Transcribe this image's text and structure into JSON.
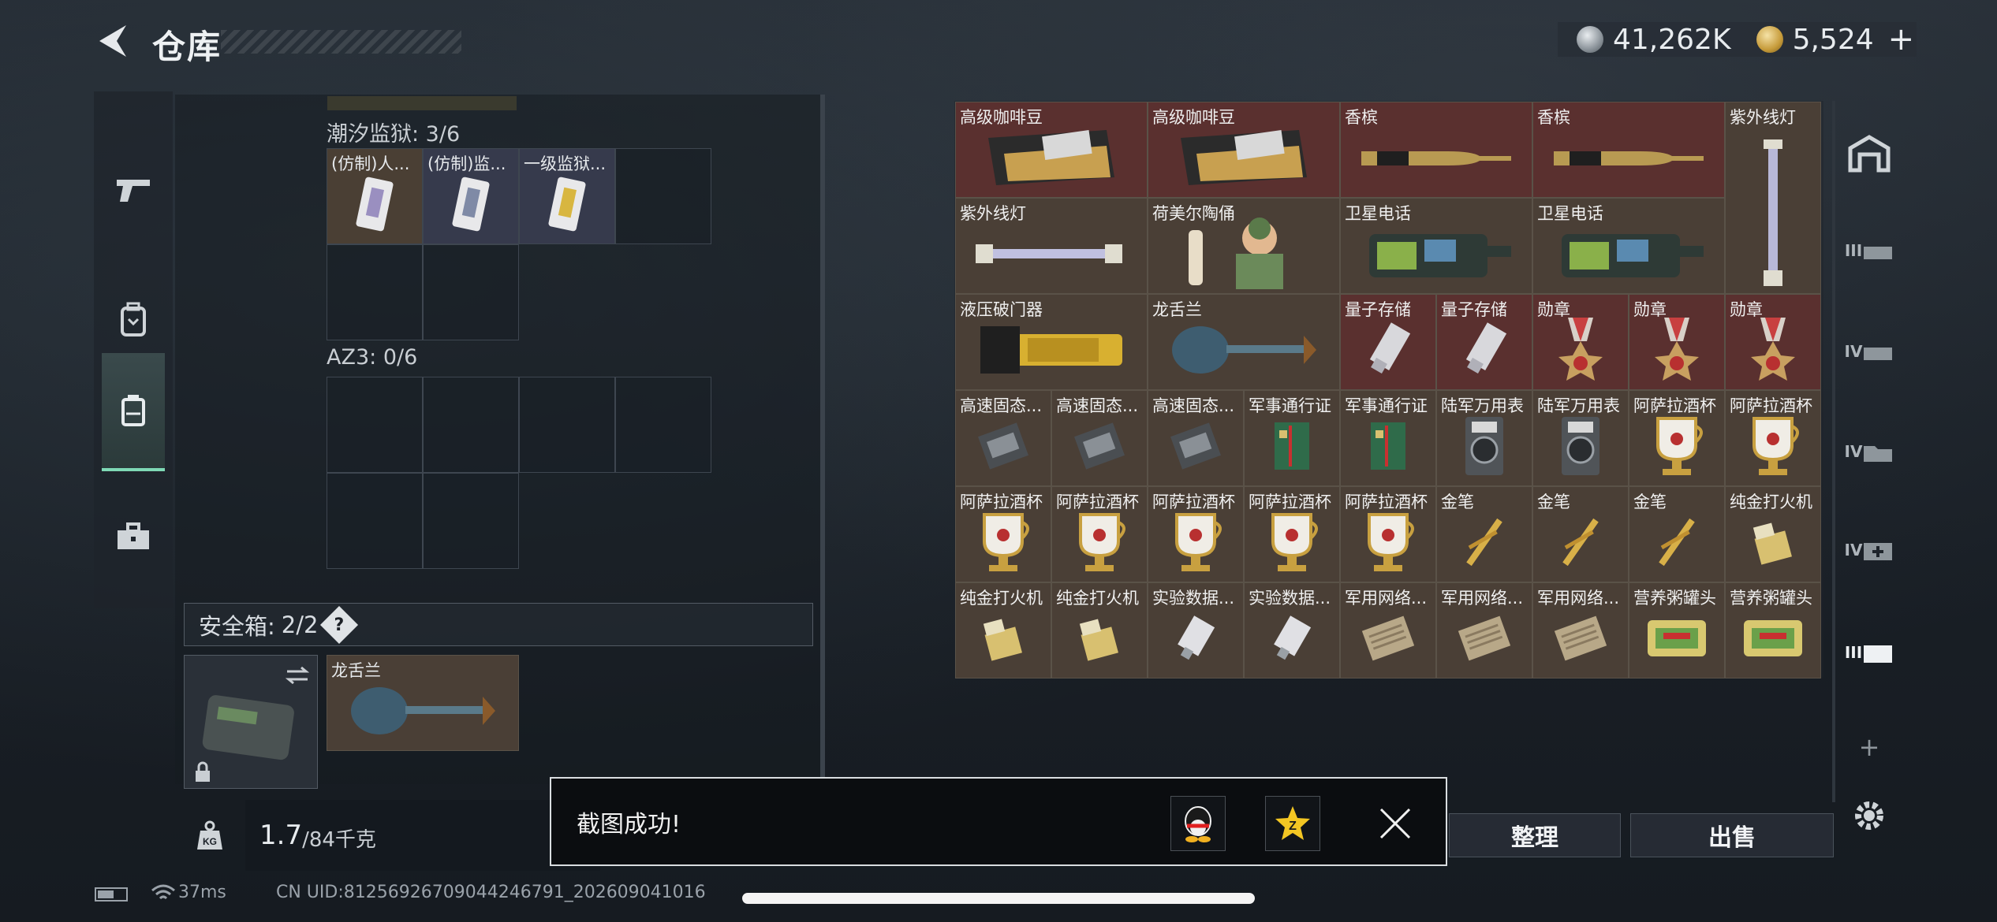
{
  "header": {
    "title": "仓库",
    "back_icon": "back-arrow-icon",
    "currency": [
      {
        "icon": "silver-coin-icon",
        "value": "41,262K"
      },
      {
        "icon": "gold-coin-icon",
        "value": "5,524"
      }
    ],
    "plus_label": "+"
  },
  "left_nav": [
    {
      "icon": "pistol-icon"
    },
    {
      "icon": "backpack-icon"
    },
    {
      "icon": "container-icon",
      "active": true
    },
    {
      "icon": "toolbox-icon"
    }
  ],
  "backpack": {
    "sections": [
      {
        "label": "潮汐监狱: 3/6",
        "items": [
          {
            "name": "(仿制)人...",
            "tint": "#5a4a3a"
          },
          {
            "name": "(仿制)监...",
            "tint": "#3e4356"
          },
          {
            "name": "一级监狱...",
            "tint": "#3e4356"
          }
        ]
      },
      {
        "label": "AZ3: 0/6",
        "items": []
      }
    ],
    "safe_box": {
      "label": "安全箱:",
      "count": "2/2",
      "help": "?",
      "item": {
        "name": "龙舌兰"
      }
    },
    "weight": {
      "current": "1.7",
      "max": "/84千克",
      "icon": "kg-weight-icon"
    }
  },
  "storage": {
    "items": [
      {
        "name": "高级咖啡豆",
        "icon": "coffee-bag-icon",
        "red": true,
        "span": 2
      },
      {
        "name": "高级咖啡豆",
        "icon": "coffee-bag-icon",
        "red": true,
        "span": 2
      },
      {
        "name": "香槟",
        "icon": "champagne-icon",
        "red": true,
        "span": 2
      },
      {
        "name": "香槟",
        "icon": "champagne-icon",
        "red": true,
        "span": 2
      },
      {
        "name": "紫外线灯",
        "icon": "uv-lamp-icon",
        "red": false,
        "span": 1,
        "rows": 2
      },
      {
        "name": "紫外线灯",
        "icon": "uv-lamp-icon",
        "red": false,
        "span": 2
      },
      {
        "name": "荷美尔陶俑",
        "icon": "figurine-icon",
        "red": false,
        "span": 2
      },
      {
        "name": "卫星电话",
        "icon": "sat-phone-icon",
        "red": false,
        "span": 2
      },
      {
        "name": "卫星电话",
        "icon": "sat-phone-icon",
        "red": false,
        "span": 2
      },
      {
        "name": "液压破门器",
        "icon": "breacher-icon",
        "red": false,
        "span": 2
      },
      {
        "name": "龙舌兰",
        "icon": "tequila-icon",
        "red": false,
        "span": 2
      },
      {
        "name": "量子存储",
        "icon": "quantum-drive-icon",
        "red": true,
        "span": 1
      },
      {
        "name": "量子存储",
        "icon": "quantum-drive-icon",
        "red": true,
        "span": 1
      },
      {
        "name": "勋章",
        "icon": "medal-icon",
        "red": true,
        "span": 1
      },
      {
        "name": "勋章",
        "icon": "medal-icon",
        "red": true,
        "span": 1
      },
      {
        "name": "勋章",
        "icon": "medal-icon",
        "red": true,
        "span": 1
      },
      {
        "name": "高速固态...",
        "icon": "ssd-icon",
        "red": false,
        "span": 1
      },
      {
        "name": "高速固态...",
        "icon": "ssd-icon",
        "red": false,
        "span": 1
      },
      {
        "name": "高速固态...",
        "icon": "ssd-icon",
        "red": false,
        "span": 1
      },
      {
        "name": "军事通行证",
        "icon": "passbook-icon",
        "red": false,
        "span": 1
      },
      {
        "name": "军事通行证",
        "icon": "passbook-icon",
        "red": false,
        "span": 1
      },
      {
        "name": "陆军万用表",
        "icon": "multimeter-icon",
        "red": false,
        "span": 1
      },
      {
        "name": "陆军万用表",
        "icon": "multimeter-icon",
        "red": false,
        "span": 1
      },
      {
        "name": "阿萨拉酒杯",
        "icon": "goblet-icon",
        "red": false,
        "span": 1
      },
      {
        "name": "阿萨拉酒杯",
        "icon": "goblet-icon",
        "red": false,
        "span": 1
      },
      {
        "name": "阿萨拉酒杯",
        "icon": "goblet-icon",
        "red": false,
        "span": 1
      },
      {
        "name": "阿萨拉酒杯",
        "icon": "goblet-icon",
        "red": false,
        "span": 1
      },
      {
        "name": "阿萨拉酒杯",
        "icon": "goblet-icon",
        "red": false,
        "span": 1
      },
      {
        "name": "阿萨拉酒杯",
        "icon": "goblet-icon",
        "red": false,
        "span": 1
      },
      {
        "name": "阿萨拉酒杯",
        "icon": "goblet-icon",
        "red": false,
        "span": 1
      },
      {
        "name": "金笔",
        "icon": "pen-icon",
        "red": false,
        "span": 1
      },
      {
        "name": "金笔",
        "icon": "pen-icon",
        "red": false,
        "span": 1
      },
      {
        "name": "金笔",
        "icon": "pen-icon",
        "red": false,
        "span": 1
      },
      {
        "name": "纯金打火机",
        "icon": "lighter-icon",
        "red": false,
        "span": 1
      },
      {
        "name": "纯金打火机",
        "icon": "lighter-icon",
        "red": false,
        "span": 1
      },
      {
        "name": "纯金打火机",
        "icon": "lighter-icon",
        "red": false,
        "span": 1
      },
      {
        "name": "实验数据...",
        "icon": "usb-icon",
        "red": false,
        "span": 1
      },
      {
        "name": "实验数据...",
        "icon": "usb-icon",
        "red": false,
        "span": 1
      },
      {
        "name": "军用网络...",
        "icon": "network-box-icon",
        "red": false,
        "span": 1
      },
      {
        "name": "军用网络...",
        "icon": "network-box-icon",
        "red": false,
        "span": 1
      },
      {
        "name": "军用网络...",
        "icon": "network-box-icon",
        "red": false,
        "span": 1
      },
      {
        "name": "营养粥罐头",
        "icon": "can-icon",
        "red": false,
        "span": 1
      },
      {
        "name": "营养粥罐头",
        "icon": "can-icon",
        "red": false,
        "span": 1
      }
    ],
    "buttons": {
      "sort": "整理",
      "sell": "出售"
    }
  },
  "right_nav": [
    {
      "icon": "warehouse-icon",
      "label": ""
    },
    {
      "icon": "tier-III-armor-icon",
      "label": "III"
    },
    {
      "icon": "tier-IV-armor-icon",
      "label": "IV"
    },
    {
      "icon": "tier-IV-container-icon",
      "label": "IV"
    },
    {
      "icon": "tier-IV-medkit-icon",
      "label": "IV"
    },
    {
      "icon": "tier-III-selected-icon",
      "label": "III"
    },
    {
      "icon": "add-tab-icon",
      "label": "+"
    },
    {
      "icon": "gear-icon",
      "label": ""
    }
  ],
  "toast": {
    "message": "截图成功!",
    "qq_icon": "qq-penguin-icon",
    "qzone_icon": "qzone-star-icon",
    "close_icon": "close-icon"
  },
  "footer": {
    "ping": "37ms",
    "uid": "CN UID:8125692670904424679​1_202609041016"
  }
}
